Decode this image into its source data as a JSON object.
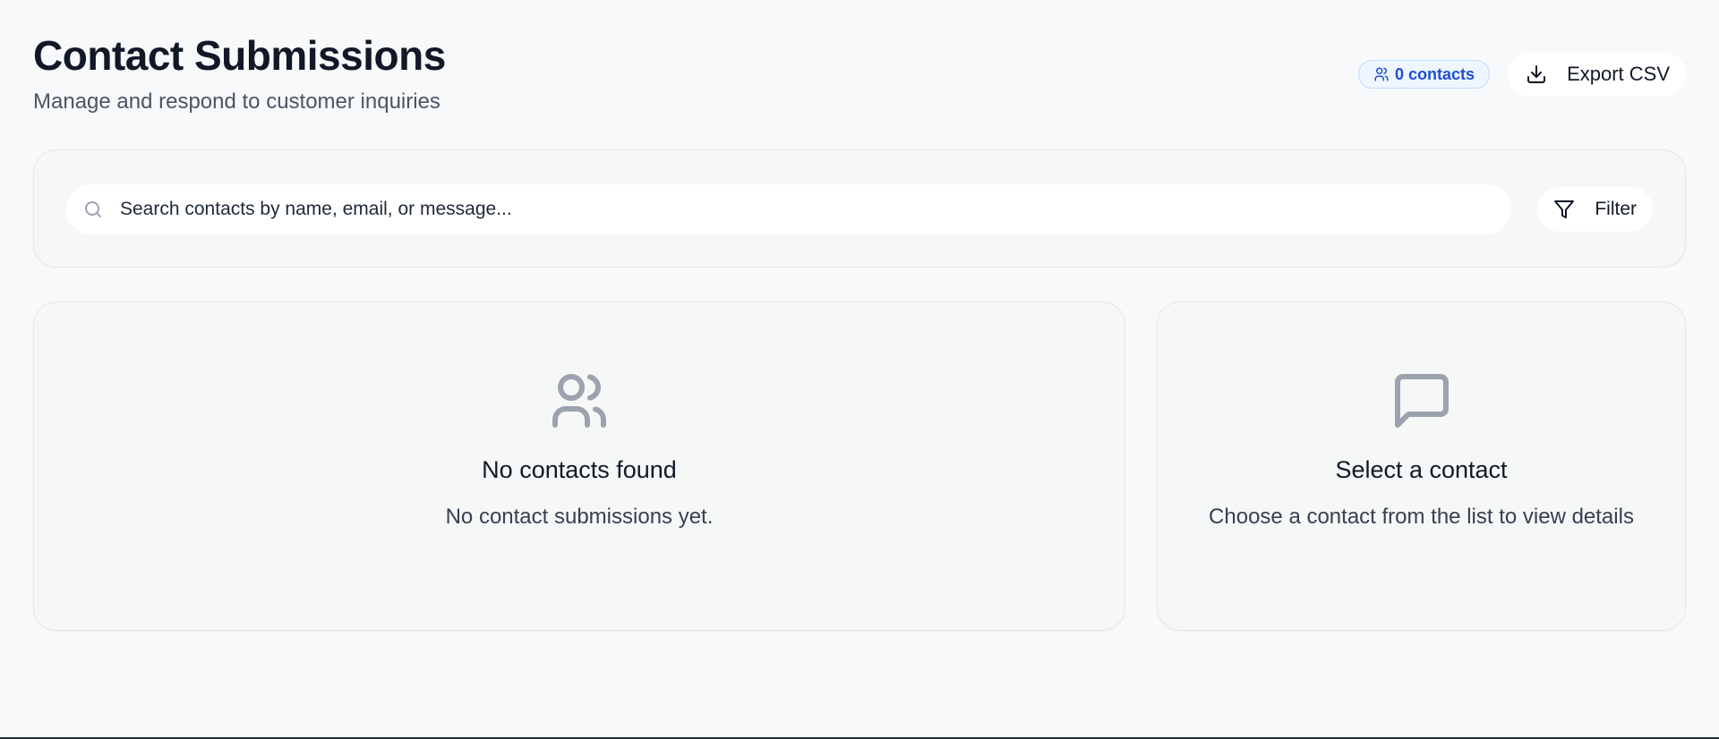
{
  "header": {
    "title": "Contact Submissions",
    "subtitle": "Manage and respond to customer inquiries",
    "contact_count": "0 contacts",
    "export_label": "Export CSV"
  },
  "search": {
    "placeholder": "Search contacts by name, email, or message...",
    "filter_label": "Filter"
  },
  "contact_list": {
    "empty_icon": "users-icon",
    "empty_title": "No contacts found",
    "empty_text": "No contact submissions yet."
  },
  "contact_detail": {
    "empty_icon": "message-square-icon",
    "empty_title": "Select a contact",
    "empty_text": "Choose a contact from the list to view details"
  },
  "colors": {
    "background": "#f8f9fa",
    "badge_text": "#1d4ed8",
    "badge_border": "#bfdbfe",
    "icon_muted": "#9ca3af"
  }
}
